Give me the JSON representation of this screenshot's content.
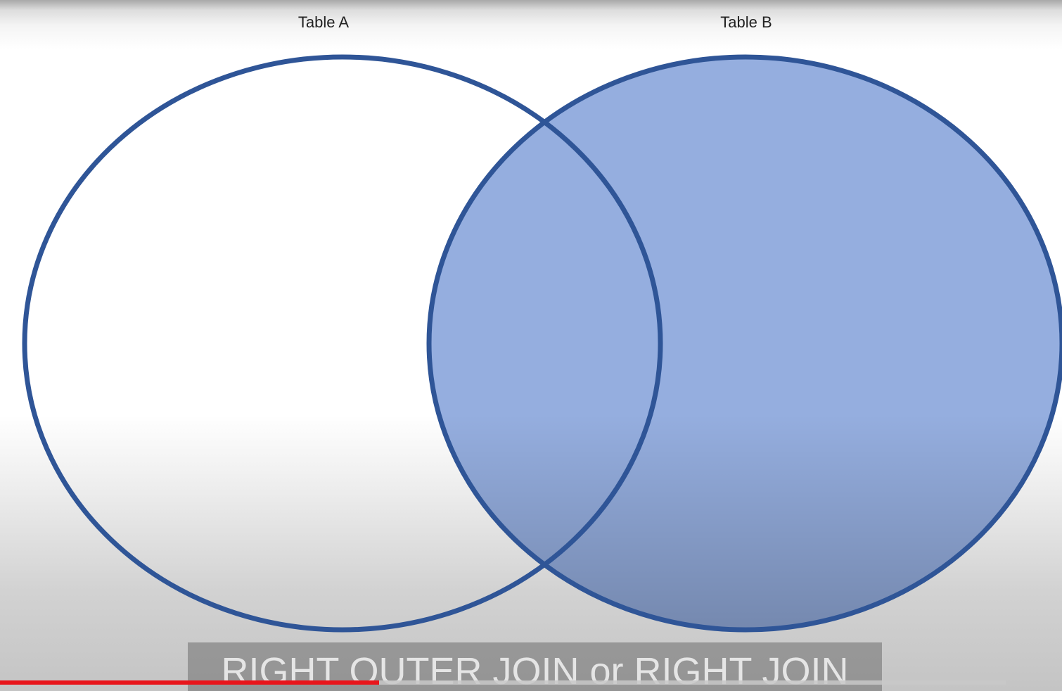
{
  "diagram": {
    "set_a": {
      "label": "Table A"
    },
    "set_b": {
      "label": "Table B"
    },
    "highlighted_region": "table-b",
    "colors": {
      "outline": "#2f5597",
      "fill": "#95aedf",
      "background": "#ffffff"
    }
  },
  "caption": {
    "text": "RIGHT OUTER JOIN or RIGHT JOIN"
  },
  "player": {
    "progress_fraction": 0.377,
    "progress_color": "#e8151b"
  }
}
